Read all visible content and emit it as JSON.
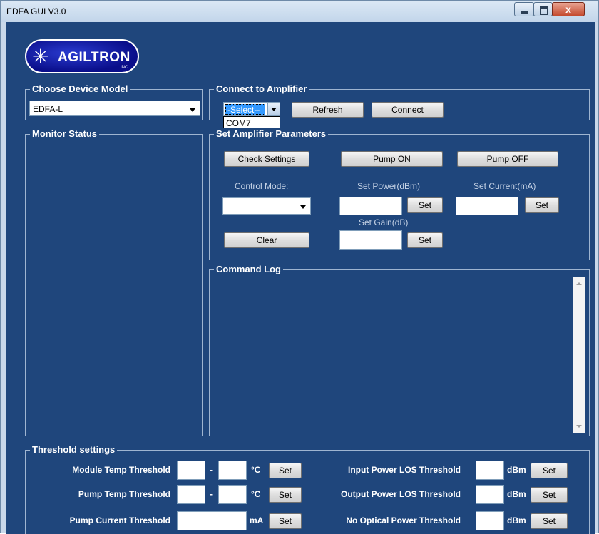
{
  "window": {
    "title": "EDFA GUI V3.0",
    "close_label": "x"
  },
  "logo": {
    "brand": "AGILTRON",
    "suffix": "INC",
    "star_glyph": "✳"
  },
  "device_model": {
    "title": "Choose Device Model",
    "selected": "EDFA-L"
  },
  "connect": {
    "title": "Connect to Amplifier",
    "port_selected": "-Select--",
    "port_options": [
      "COM7"
    ],
    "refresh_label": "Refresh",
    "connect_label": "Connect"
  },
  "monitor": {
    "title": "Monitor Status"
  },
  "params": {
    "title": "Set Amplifier Parameters",
    "check_settings_label": "Check Settings",
    "pump_on_label": "Pump ON",
    "pump_off_label": "Pump OFF",
    "control_mode_label": "Control Mode:",
    "control_mode_value": "",
    "set_power_label": "Set Power(dBm)",
    "set_current_label": "Set Current(mA)",
    "set_gain_label": "Set Gain(dB)",
    "set_label": "Set",
    "clear_label": "Clear"
  },
  "command_log": {
    "title": "Command Log"
  },
  "thresholds": {
    "title": "Threshold settings",
    "set_label": "Set",
    "dash": "-",
    "module_temp": {
      "label": "Module Temp Threshold",
      "unit": "°C"
    },
    "pump_temp": {
      "label": "Pump Temp Threshold",
      "unit": "°C"
    },
    "pump_current": {
      "label": "Pump Current Threshold",
      "unit": "mA"
    },
    "input_los": {
      "label": "Input Power LOS Threshold",
      "unit": "dBm"
    },
    "output_los": {
      "label": "Output Power LOS Threshold",
      "unit": "dBm"
    },
    "no_optical": {
      "label": "No Optical Power Threshold",
      "unit": "dBm"
    }
  },
  "colors": {
    "background": "#1f467c",
    "group_border": "#9fb5d1",
    "selection": "#3399ff"
  }
}
